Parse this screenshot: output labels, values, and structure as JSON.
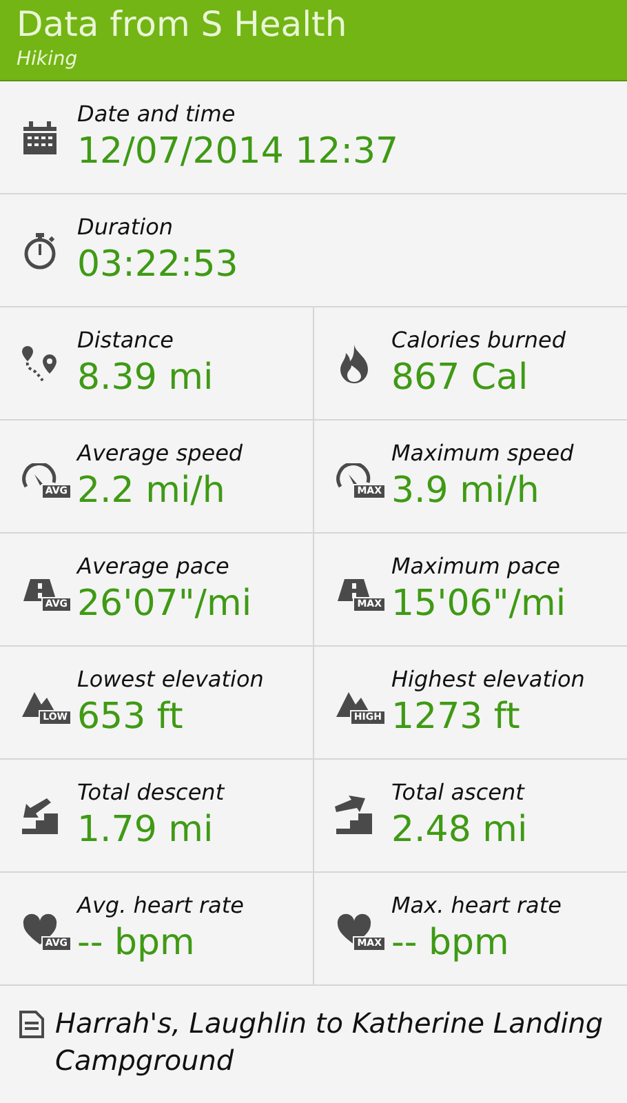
{
  "header": {
    "title": "Data from S Health",
    "subtitle": "Hiking"
  },
  "rows": [
    {
      "cells": [
        {
          "kind": "calendar",
          "label": "Date and time",
          "value": "12/07/2014 12:37"
        }
      ]
    },
    {
      "cells": [
        {
          "kind": "stopwatch",
          "label": "Duration",
          "value": "03:22:53"
        }
      ]
    },
    {
      "cells": [
        {
          "kind": "route",
          "label": "Distance",
          "value": "8.39 mi"
        },
        {
          "kind": "flame",
          "label": "Calories burned",
          "value": "867 Cal"
        }
      ]
    },
    {
      "cells": [
        {
          "kind": "speedometer",
          "badge": "AVG",
          "label": "Average speed",
          "value": "2.2 mi/h"
        },
        {
          "kind": "speedometer",
          "badge": "MAX",
          "label": "Maximum speed",
          "value": "3.9 mi/h"
        }
      ]
    },
    {
      "cells": [
        {
          "kind": "pace",
          "badge": "AVG",
          "label": "Average pace",
          "value": "26'07\"/mi"
        },
        {
          "kind": "pace",
          "badge": "MAX",
          "label": "Maximum pace",
          "value": "15'06\"/mi"
        }
      ]
    },
    {
      "cells": [
        {
          "kind": "mountain",
          "badge": "LOW",
          "label": "Lowest elevation",
          "value": "653 ft"
        },
        {
          "kind": "mountain",
          "badge": "HIGH",
          "label": "Highest elevation",
          "value": "1273 ft"
        }
      ]
    },
    {
      "cells": [
        {
          "kind": "descent",
          "label": "Total descent",
          "value": "1.79 mi"
        },
        {
          "kind": "ascent",
          "label": "Total ascent",
          "value": "2.48 mi"
        }
      ]
    },
    {
      "cells": [
        {
          "kind": "heart",
          "badge": "AVG",
          "label": "Avg. heart rate",
          "value": "-- bpm"
        },
        {
          "kind": "heart",
          "badge": "MAX",
          "label": "Max. heart rate",
          "value": "-- bpm"
        }
      ]
    }
  ],
  "note": {
    "text": "Harrah's, Laughlin to Katherine Landing Campground"
  }
}
